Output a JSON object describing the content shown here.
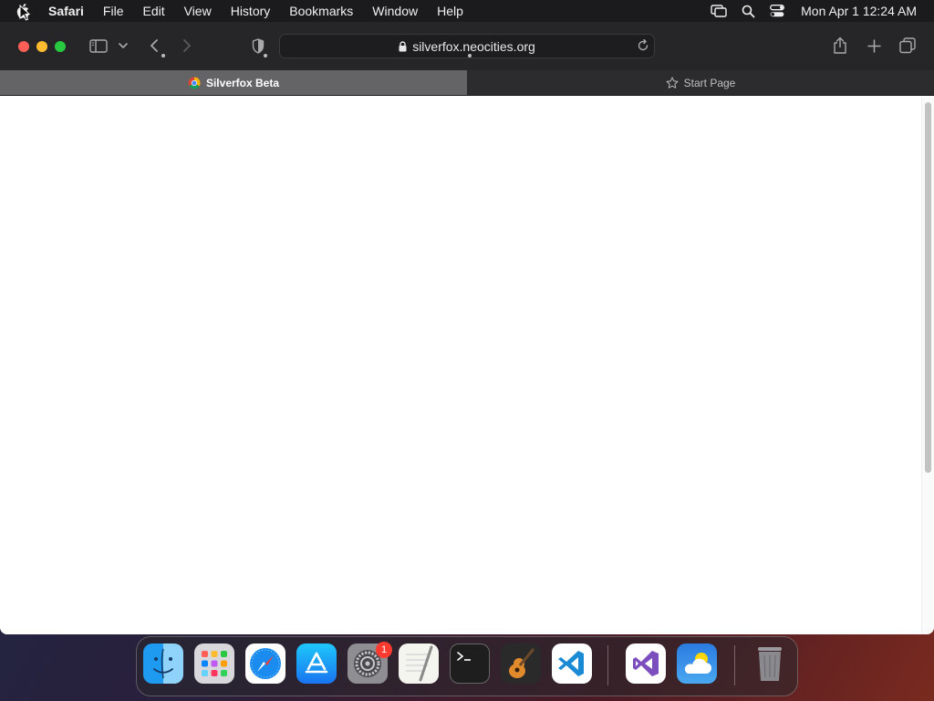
{
  "menubar": {
    "app": "Safari",
    "items": [
      "File",
      "Edit",
      "View",
      "History",
      "Bookmarks",
      "Window",
      "Help"
    ],
    "clock": "Mon Apr 1  12:24 AM"
  },
  "toolbar": {
    "url": "silverfox.neocities.org"
  },
  "tabs": [
    {
      "label": "Silverfox Beta",
      "active": true,
      "icon": "chrome-icon"
    },
    {
      "label": "Start Page",
      "active": false,
      "icon": "star-icon"
    }
  ],
  "dock": {
    "apps": [
      "Finder",
      "Launchpad",
      "Safari",
      "App Store",
      "System Settings",
      "TextEdit",
      "Terminal",
      "GarageBand",
      "Visual Studio Code",
      "Visual Studio",
      "Weather",
      "Trash"
    ],
    "settings_badge": "1"
  },
  "colors": {
    "close": "#ff5f57",
    "minimize": "#febc2e",
    "zoom": "#28c840",
    "accent": "#0a84ff"
  }
}
